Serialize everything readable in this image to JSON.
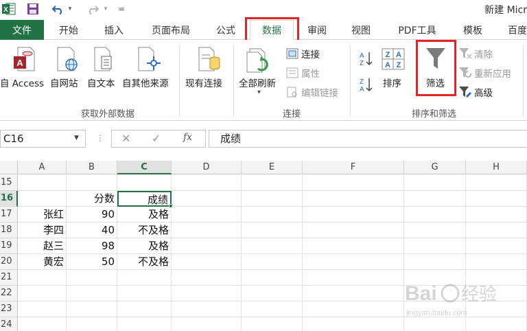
{
  "titlebar": {
    "title": "新建 Micr",
    "excel_logo": "X",
    "undo_arrow": "▾",
    "redo_arrow": "▾",
    "customize": "="
  },
  "tabs": [
    {
      "label": "文件",
      "name": "tab-file"
    },
    {
      "label": "开始",
      "name": "tab-home"
    },
    {
      "label": "插入",
      "name": "tab-insert"
    },
    {
      "label": "页面布局",
      "name": "tab-page-layout"
    },
    {
      "label": "公式",
      "name": "tab-formulas"
    },
    {
      "label": "数据",
      "name": "tab-data"
    },
    {
      "label": "审阅",
      "name": "tab-review"
    },
    {
      "label": "视图",
      "name": "tab-view"
    },
    {
      "label": "PDF工具",
      "name": "tab-pdf-tools"
    },
    {
      "label": "模板",
      "name": "tab-templates"
    },
    {
      "label": "百度",
      "name": "tab-baidu"
    }
  ],
  "ribbon": {
    "external": {
      "access": "自 Access",
      "web": "自网站",
      "text": "自文本",
      "other": "自其他来源",
      "existing": "现有连接",
      "group": "获取外部数据"
    },
    "connections": {
      "refresh_all": "全部刷新",
      "refresh_arrow": "▾",
      "connections": "连接",
      "properties": "属性",
      "edit_links": "编辑链接",
      "group": "连接"
    },
    "sortfilter": {
      "sort": "排序",
      "filter": "筛选",
      "clear": "清除",
      "reapply": "重新应用",
      "advanced": "高级",
      "group": "排序和筛选"
    }
  },
  "formula_bar": {
    "name_box": "C16",
    "cancel": "✕",
    "enter": "✓",
    "fx": "fx",
    "dots": "⋮",
    "value": "成绩"
  },
  "sheet": {
    "columns": [
      "A",
      "B",
      "C",
      "D",
      "E",
      "F",
      "G",
      "H"
    ],
    "rows": [
      "15",
      "16",
      "17",
      "18",
      "19",
      "20",
      "21",
      "22",
      "23",
      "24"
    ],
    "selected_col": "C",
    "selected_row": "16",
    "cells": {
      "B16": "分数",
      "C16": "成绩",
      "A17": "张红",
      "B17": "90",
      "C17": "及格",
      "A18": "李四",
      "B18": "40",
      "C18": "不及格",
      "A19": "赵三",
      "B19": "98",
      "C19": "及格",
      "A20": "黄宏",
      "B20": "50",
      "C20": "不及格"
    }
  },
  "watermark": {
    "text": "Bai",
    "text2": "经验",
    "url": "jingyan.baidu.com"
  },
  "colors": {
    "excel_green": "#217346",
    "highlight_red": "#e0262a"
  }
}
